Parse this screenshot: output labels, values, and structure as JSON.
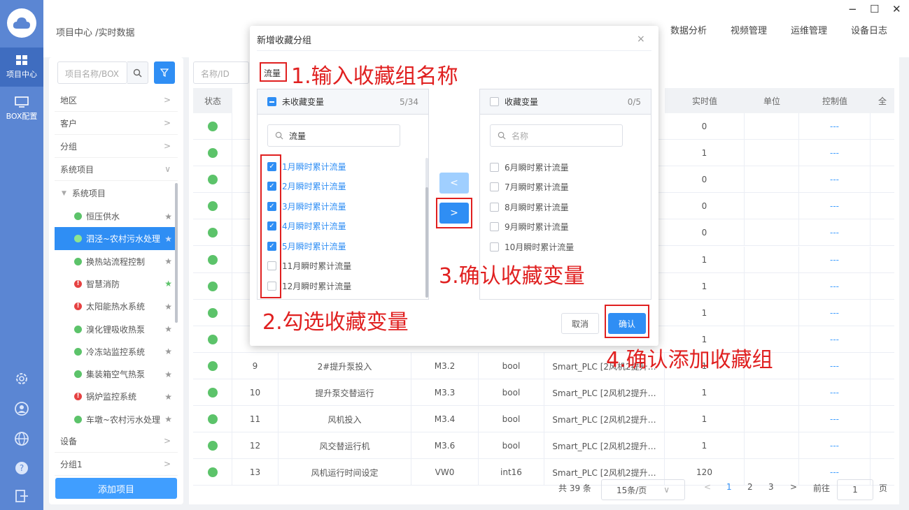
{
  "window": {
    "minimize": "−",
    "maximize": "☐",
    "close": "✕"
  },
  "rail": {
    "items": [
      {
        "label": "项目中心",
        "active": true
      },
      {
        "label": "BOX配置",
        "active": false
      }
    ]
  },
  "header": {
    "breadcrumb": "项目中心 /实时数据",
    "nav": [
      "数据分析",
      "视频管理",
      "运维管理",
      "设备日志"
    ]
  },
  "sidebar": {
    "search_placeholder": "项目名称/BOX",
    "groups": [
      {
        "label": "地区",
        "arrow": ">"
      },
      {
        "label": "客户",
        "arrow": ">"
      },
      {
        "label": "分组",
        "arrow": ">"
      },
      {
        "label": "系统项目",
        "arrow": "∨"
      }
    ],
    "tree_parent": "系统项目",
    "projects": [
      {
        "label": "恒压供水",
        "status": "ok",
        "star": false
      },
      {
        "label": "泗泾~农村污水处理",
        "status": "ok",
        "star": false,
        "selected": true
      },
      {
        "label": "换热站流程控制",
        "status": "ok",
        "star": false
      },
      {
        "label": "智慧消防",
        "status": "alarm",
        "star": true
      },
      {
        "label": "太阳能热水系统",
        "status": "alarm",
        "star": false
      },
      {
        "label": "溴化锂吸收热泵",
        "status": "ok",
        "star": false
      },
      {
        "label": "冷冻站监控系统",
        "status": "ok",
        "star": false
      },
      {
        "label": "集装箱空气热泵",
        "status": "ok",
        "star": false
      },
      {
        "label": "锅炉监控系统",
        "status": "alarm",
        "star": false
      },
      {
        "label": "车墩~农村污水处理",
        "status": "ok",
        "star": false
      }
    ],
    "bottom_groups": [
      {
        "label": "设备",
        "arrow": ">"
      },
      {
        "label": "分组1",
        "arrow": ">"
      }
    ],
    "add_button": "添加项目"
  },
  "table": {
    "filter_placeholder": "名称/ID",
    "headers": {
      "status": "状态",
      "value": "实时值",
      "unit": "单位",
      "control": "控制值",
      "extra": "全"
    },
    "top_values": [
      "0",
      "1",
      "0",
      "0",
      "0",
      "1",
      "1",
      "1",
      "1"
    ],
    "rows": [
      {
        "no": "9",
        "name": "2#提升泵投入",
        "addr": "M3.2",
        "type": "bool",
        "device": "Smart_PLC [2风机2提升…",
        "value": "1",
        "control": "---"
      },
      {
        "no": "10",
        "name": "提升泵交替运行",
        "addr": "M3.3",
        "type": "bool",
        "device": "Smart_PLC [2风机2提升…",
        "value": "1",
        "control": "---"
      },
      {
        "no": "11",
        "name": "风机投入",
        "addr": "M3.4",
        "type": "bool",
        "device": "Smart_PLC [2风机2提升…",
        "value": "1",
        "control": "---"
      },
      {
        "no": "12",
        "name": "风交替运行机",
        "addr": "M3.6",
        "type": "bool",
        "device": "Smart_PLC [2风机2提升…",
        "value": "1",
        "control": "---"
      },
      {
        "no": "13",
        "name": "风机运行时间设定",
        "addr": "VW0",
        "type": "int16",
        "device": "Smart_PLC [2风机2提升…",
        "value": "120",
        "control": "---"
      }
    ],
    "control_dash": "---"
  },
  "pager": {
    "total": "共 39 条",
    "page_size": "15条/页",
    "pages": [
      "1",
      "2",
      "3"
    ],
    "goto_label": "前往",
    "goto_value": "1",
    "page_suffix": "页",
    "prev": "<",
    "next": ">"
  },
  "dialog": {
    "title": "新增收藏分组",
    "close": "×",
    "group_name": "流量",
    "left_panel": {
      "title": "未收藏变量",
      "count": "5/34",
      "search_value": "流量",
      "items": [
        {
          "label": "1月瞬时累计流量",
          "checked": true
        },
        {
          "label": "2月瞬时累计流量",
          "checked": true
        },
        {
          "label": "3月瞬时累计流量",
          "checked": true
        },
        {
          "label": "4月瞬时累计流量",
          "checked": true
        },
        {
          "label": "5月瞬时累计流量",
          "checked": true
        },
        {
          "label": "11月瞬时累计流量",
          "checked": false
        },
        {
          "label": "12月瞬时累计流量",
          "checked": false
        }
      ]
    },
    "right_panel": {
      "title": "收藏变量",
      "count": "0/5",
      "search_placeholder": "名称",
      "items": [
        "6月瞬时累计流量",
        "7月瞬时累计流量",
        "8月瞬时累计流量",
        "9月瞬时累计流量",
        "10月瞬时累计流量"
      ]
    },
    "move_left": "<",
    "move_right": ">",
    "cancel": "取消",
    "confirm": "确认"
  },
  "annotations": {
    "step1": "1.输入收藏组名称",
    "step2": "2.勾选收藏变量",
    "step3": "3.确认收藏变量",
    "step4": "4.确认添加收藏组"
  },
  "colors": {
    "primary": "#2f8ef4",
    "rail": "#5b86d3",
    "annotation": "#e02020",
    "ok": "#5cc36a",
    "alarm": "#e64242"
  }
}
